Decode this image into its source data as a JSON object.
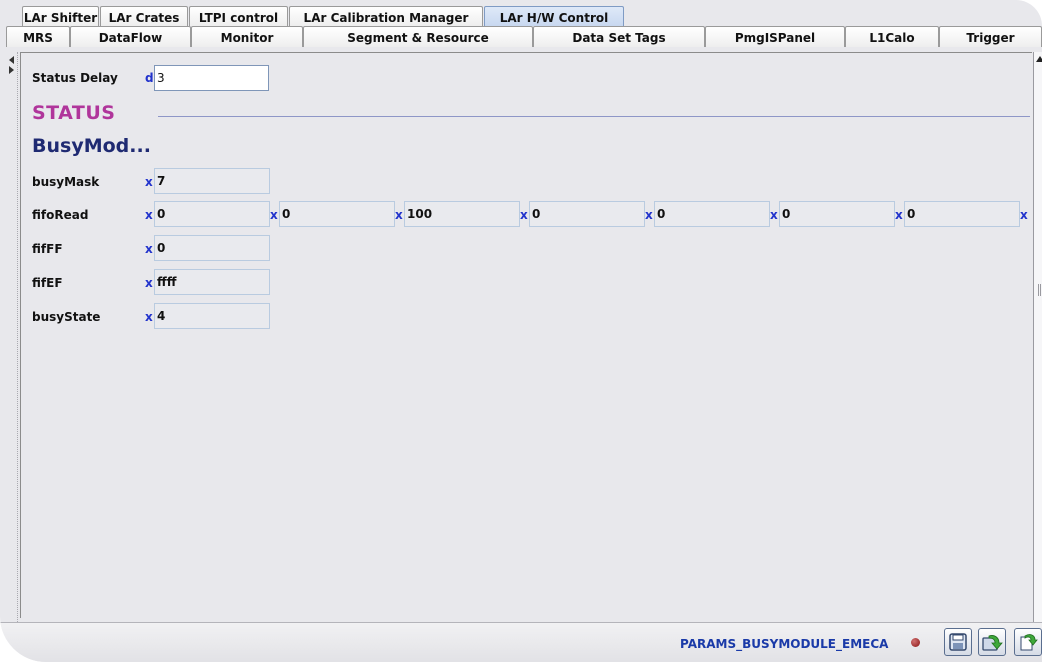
{
  "tabs_row1": [
    {
      "label": "LAr Shifter",
      "active": false
    },
    {
      "label": "LAr Crates",
      "active": false
    },
    {
      "label": "LTPI control",
      "active": false
    },
    {
      "label": "LAr Calibration Manager",
      "active": false
    },
    {
      "label": "LAr H/W Control",
      "active": true
    }
  ],
  "tabs_row2": [
    {
      "label": "MRS"
    },
    {
      "label": "DataFlow"
    },
    {
      "label": "Monitor"
    },
    {
      "label": "Segment & Resource"
    },
    {
      "label": "Data Set Tags"
    },
    {
      "label": "PmgISPanel"
    },
    {
      "label": "L1Calo"
    },
    {
      "label": "Trigger"
    }
  ],
  "status_delay": {
    "label": "Status Delay",
    "prefix": "d",
    "value": "3"
  },
  "section_title": "STATUS",
  "module_title": "BusyMod...",
  "rows": [
    {
      "label": "busyMask",
      "prefix": "x",
      "values": [
        "7"
      ]
    },
    {
      "label": "fifoRead",
      "prefix": "x",
      "values": [
        "0",
        "0",
        "100",
        "0",
        "0",
        "0",
        "0",
        ""
      ]
    },
    {
      "label": "fifFF",
      "prefix": "x",
      "values": [
        "0"
      ]
    },
    {
      "label": "fifEF",
      "prefix": "x",
      "values": [
        "ffff"
      ]
    },
    {
      "label": "busyState",
      "prefix": "x",
      "values": [
        "4"
      ]
    }
  ],
  "footer": {
    "module_name": "PARAMS_BUSYMODULE_EMECA",
    "status_dot_color": "#8a1414",
    "icons": [
      "save-icon",
      "load-icon",
      "refresh-icon"
    ]
  }
}
